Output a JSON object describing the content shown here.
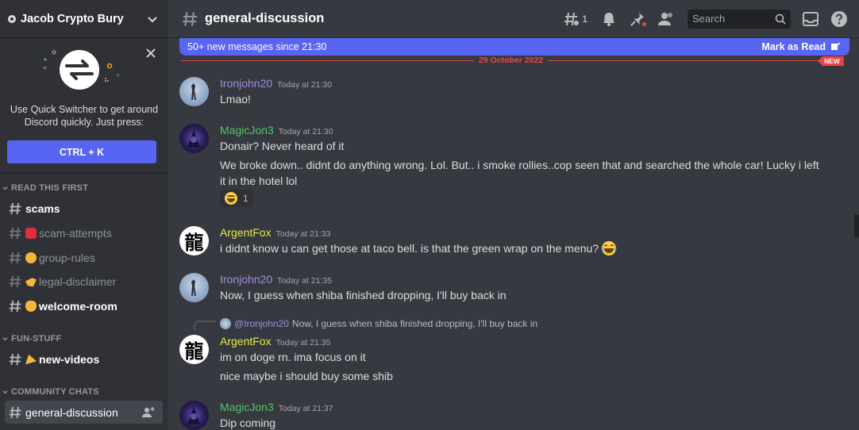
{
  "server": {
    "name": "Jacob Crypto Bury"
  },
  "quick_switcher": {
    "text": "Use Quick Switcher to get around Discord quickly. Just press:",
    "shortcut": "CTRL + K"
  },
  "categories": [
    {
      "label": "READ THIS FIRST"
    },
    {
      "label": "FUN-STUFF"
    },
    {
      "label": "COMMUNITY CHATS"
    }
  ],
  "channels": [
    {
      "name": "scams",
      "emoji": "",
      "state": "unread"
    },
    {
      "name": "scam-attempts",
      "emoji": "sos-icon",
      "state": "read"
    },
    {
      "name": "group-rules",
      "emoji": "handshake-icon",
      "state": "read"
    },
    {
      "name": "legal-disclaimer",
      "emoji": "pointing-hand-icon",
      "state": "read"
    },
    {
      "name": "welcome-room",
      "emoji": "waving-hand-icon",
      "state": "unread"
    },
    {
      "name": "new-videos",
      "emoji": "party-popper-icon",
      "state": "unread"
    },
    {
      "name": "general-discussion",
      "emoji": "",
      "state": "active"
    }
  ],
  "header": {
    "title": "general-discussion",
    "threads_count": "1",
    "search_placeholder": "Search"
  },
  "banner": {
    "message": "50+ new messages since 21:30",
    "action": "Mark as Read"
  },
  "divider": {
    "date": "29 October 2022",
    "new_label": "NEW"
  },
  "messages": [
    {
      "author": "Ironjohn20",
      "time": "Today at 21:30",
      "lines": [
        "Lmao!"
      ]
    },
    {
      "author": "MagicJon3",
      "time": "Today at 21:30",
      "lines": [
        "Donair? Never heard of it",
        "We broke down.. didnt do anything wrong. Lol. But.. i smoke rollies..cop seen that and searched the whole car! Lucky i left it in the hotel lol"
      ],
      "reaction": {
        "emoji": "joy-icon",
        "count": "1"
      }
    },
    {
      "author": "ArgentFox",
      "time": "Today at 21:33",
      "lines": [
        "i didnt know u can get those at taco bell. is that the green wrap on the menu?"
      ]
    },
    {
      "author": "Ironjohn20",
      "time": "Today at 21:35",
      "lines": [
        "Now, I guess when shiba finished dropping, I'll buy back in"
      ]
    },
    {
      "author": "ArgentFox",
      "time": "Today at 21:35",
      "reply": {
        "mention": "@Ironjohn20",
        "text": "Now, I guess when shiba finished dropping, I'll buy back in"
      },
      "lines": [
        "im on doge rn. ima focus on it",
        "nice maybe i should buy some shib"
      ]
    },
    {
      "author": "MagicJon3",
      "time": "Today at 21:37",
      "lines": [
        "Dip coming"
      ]
    }
  ],
  "avatar_glyphs": {
    "fox": "龍"
  },
  "colors": {
    "blurple": "#5865f2",
    "iron": "#a08fe0",
    "magic": "#55c46a",
    "fox": "#e8e94a",
    "new_red": "#ed4245"
  }
}
